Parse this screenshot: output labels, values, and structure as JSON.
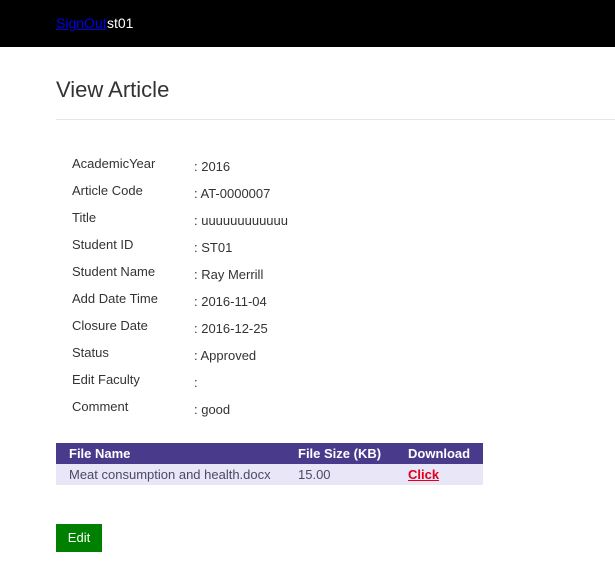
{
  "header": {
    "signout_label": "SignOut",
    "username": "st01"
  },
  "page": {
    "title": "View Article"
  },
  "fields": [
    {
      "label": "AcademicYear",
      "value": ": 2016"
    },
    {
      "label": "Article Code",
      "value": ": AT-0000007"
    },
    {
      "label": "Title",
      "value": ": uuuuuuuuuuuu"
    },
    {
      "label": "Student ID",
      "value": ": ST01"
    },
    {
      "label": "Student Name",
      "value": ": Ray Merrill"
    },
    {
      "label": "Add Date Time",
      "value": ": 2016-11-04"
    },
    {
      "label": "Closure Date",
      "value": ": 2016-12-25"
    },
    {
      "label": "Status",
      "value": ": Approved"
    },
    {
      "label": "Edit Faculty",
      "value": ":"
    },
    {
      "label": "Comment",
      "value": ": good"
    }
  ],
  "files_table": {
    "headers": [
      "File Name",
      "File Size (KB)",
      "Download"
    ],
    "rows": [
      {
        "file_name": "Meat consumption and health.docx",
        "file_size": "15.00",
        "download_label": "Click"
      }
    ]
  },
  "actions": {
    "edit_label": "Edit"
  },
  "colors": {
    "topbar": "#000000",
    "table_header": "#4a3a8c",
    "table_row": "#e8e6f7",
    "edit_button": "#008000",
    "download_link": "#e0001a"
  }
}
